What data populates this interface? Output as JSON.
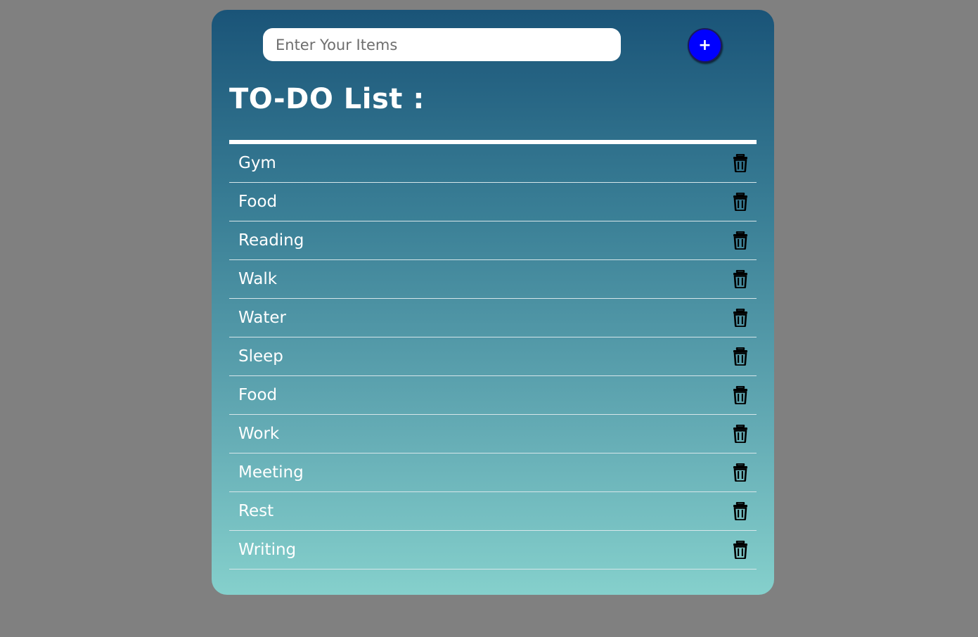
{
  "input": {
    "placeholder": "Enter Your Items",
    "value": ""
  },
  "add_button": {
    "label": "+"
  },
  "title": "TO-DO List :",
  "items": [
    {
      "label": "Gym"
    },
    {
      "label": "Food"
    },
    {
      "label": "Reading"
    },
    {
      "label": "Walk"
    },
    {
      "label": "Water"
    },
    {
      "label": "Sleep"
    },
    {
      "label": "Food"
    },
    {
      "label": "Work"
    },
    {
      "label": "Meeting"
    },
    {
      "label": "Rest"
    },
    {
      "label": "Writing"
    }
  ],
  "item_icon": "trash-icon",
  "colors": {
    "page_background": "#808080",
    "card_gradient_top": "#1a5478",
    "card_gradient_bottom": "#85d0cc",
    "add_button": "#0000ff",
    "text": "#ffffff"
  }
}
